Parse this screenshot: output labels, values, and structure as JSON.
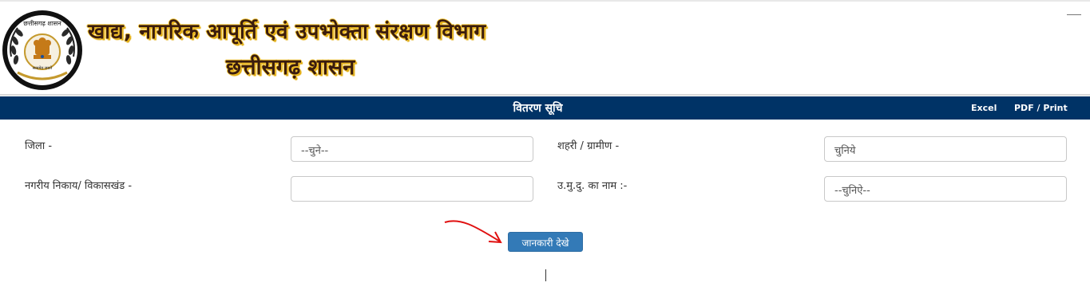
{
  "header": {
    "title_line1": "खाद्य, नागरिक आपूर्ति एवं उपभोक्ता संरक्षण विभाग",
    "title_line2": "छत्तीसगढ़ शासन",
    "emblem_top_text": "छत्तीसगढ़ शासन",
    "emblem_bottom_text": "सत्यमेव जयते"
  },
  "navbar": {
    "title": "वितरण सूचि",
    "links": [
      "Excel",
      "PDF / Print"
    ]
  },
  "form": {
    "district_label": "जिला -",
    "district_value": "--चुने--",
    "urban_rural_label": "शहरी / ग्रामीण -",
    "urban_rural_value": "चुनिये",
    "body_block_label": "नगरीय निकाय/ विकासखंड -",
    "body_block_value": "",
    "shop_name_label": "उ.मु.दु. का नाम :-",
    "shop_name_value": "--चुनिऐ--"
  },
  "submit_label": "जानकारी देखे",
  "colors": {
    "navbar": "#003366",
    "button": "#337ab7",
    "arrow": "#e01010",
    "title_glow": "#f4c430"
  }
}
